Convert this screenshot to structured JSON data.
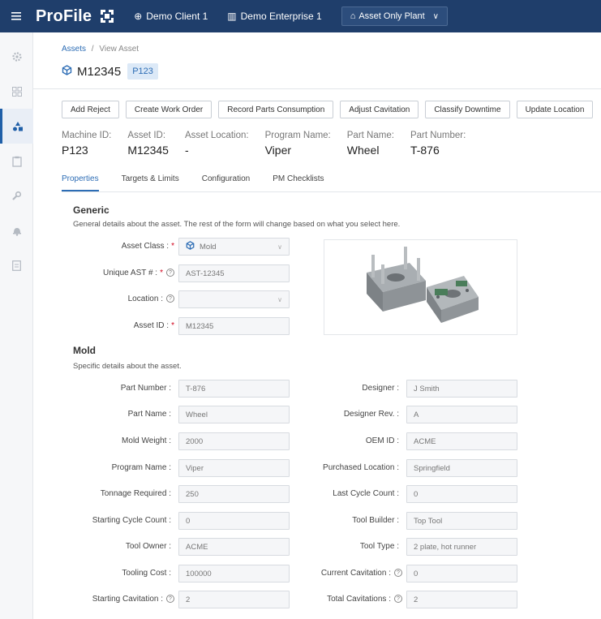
{
  "topbar": {
    "brand": "ProFile",
    "client": "Demo Client 1",
    "enterprise": "Demo Enterprise 1",
    "plant": "Asset Only Plant"
  },
  "breadcrumb": {
    "root": "Assets",
    "separator": "/",
    "current": "View Asset"
  },
  "asset": {
    "title": "M12345",
    "badge": "P123"
  },
  "actions": [
    "Add Reject",
    "Create Work Order",
    "Record Parts Consumption",
    "Adjust Cavitation",
    "Classify Downtime",
    "Update Location"
  ],
  "info": [
    {
      "label": "Machine ID:",
      "value": "P123"
    },
    {
      "label": "Asset ID:",
      "value": "M12345"
    },
    {
      "label": "Asset Location:",
      "value": "-"
    },
    {
      "label": "Program Name:",
      "value": "Viper"
    },
    {
      "label": "Part Name:",
      "value": "Wheel"
    },
    {
      "label": "Part Number:",
      "value": "T-876"
    }
  ],
  "tabs": [
    "Properties",
    "Targets & Limits",
    "Configuration",
    "PM Checklists"
  ],
  "generic": {
    "title": "Generic",
    "desc": "General details about the asset. The rest of the form will change based on what you select here.",
    "asset_class": {
      "label": "Asset Class :",
      "value": "Mold"
    },
    "unique_ast": {
      "label": "Unique AST # :",
      "value": "AST-12345"
    },
    "location": {
      "label": "Location :",
      "value": ""
    },
    "asset_id": {
      "label": "Asset ID :",
      "value": "M12345"
    }
  },
  "mold": {
    "title": "Mold",
    "desc": "Specific details about the asset.",
    "left": [
      {
        "label": "Part Number :",
        "value": "T-876"
      },
      {
        "label": "Part Name :",
        "value": "Wheel"
      },
      {
        "label": "Mold Weight :",
        "value": "2000"
      },
      {
        "label": "Program Name :",
        "value": "Viper"
      },
      {
        "label": "Tonnage Required :",
        "value": "250"
      },
      {
        "label": "Starting Cycle Count :",
        "value": "0"
      },
      {
        "label": "Tool Owner :",
        "value": "ACME"
      },
      {
        "label": "Tooling Cost :",
        "value": "100000"
      },
      {
        "label": "Starting Cavitation :",
        "value": "2"
      }
    ],
    "right": [
      {
        "label": "Designer :",
        "value": "J Smith"
      },
      {
        "label": "Designer Rev. :",
        "value": "A"
      },
      {
        "label": "OEM ID :",
        "value": "ACME"
      },
      {
        "label": "Purchased Location :",
        "value": "Springfield"
      },
      {
        "label": "Last Cycle Count :",
        "value": "0"
      },
      {
        "label": "Tool Builder :",
        "value": "Top Tool"
      },
      {
        "label": "Tool Type :",
        "value": "2 plate, hot runner"
      },
      {
        "label": "Current Cavitation :",
        "value": "0"
      },
      {
        "label": "Total Cavitations :",
        "value": "2"
      }
    ]
  },
  "icons": {
    "accent": "#2d6db5",
    "topbar": "#1f3e6b"
  }
}
